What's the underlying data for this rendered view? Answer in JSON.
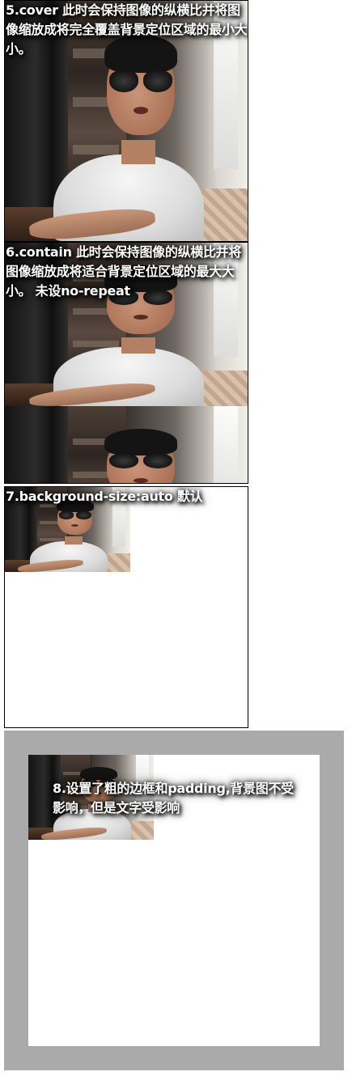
{
  "examples": [
    {
      "id": "cover",
      "text": "5.cover 此时会保持图像的纵横比并将图像缩放成将完全覆盖背景定位区域的最小大小。"
    },
    {
      "id": "contain",
      "text": "6.contain 此时会保持图像的纵横比并将图像缩放成将适合背景定位区域的最大大小。 未设no-repeat"
    },
    {
      "id": "auto",
      "text": "7.background-size:auto 默认"
    },
    {
      "id": "padding",
      "text": "8.设置了粗的边框和padding,背景图不受影响，但是文字受影响"
    }
  ],
  "colors": {
    "border_frame": "#aaaaaa",
    "box_border": "#000000",
    "text": "#ffffff"
  }
}
